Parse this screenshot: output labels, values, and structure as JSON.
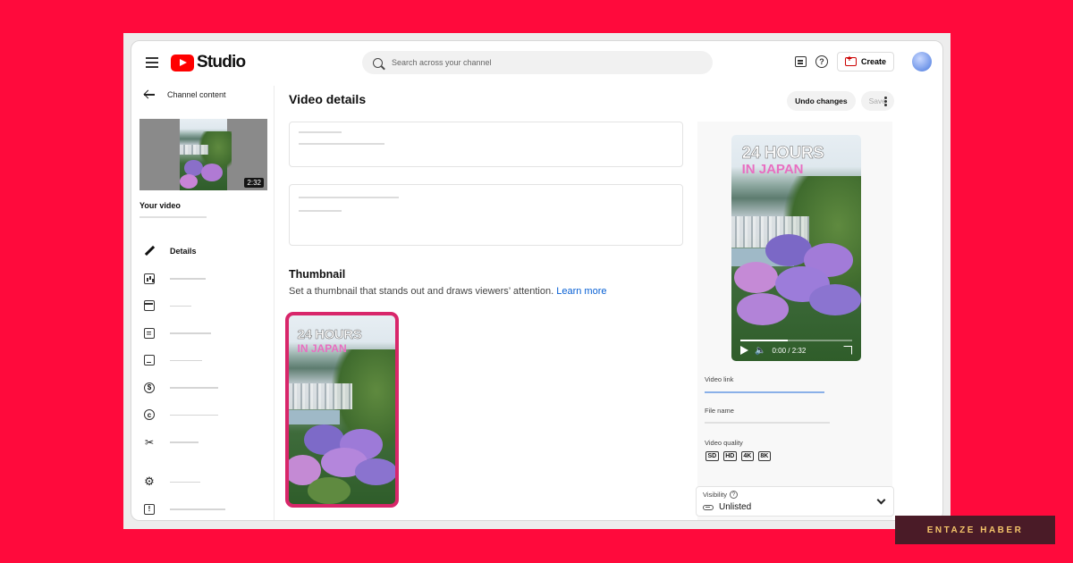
{
  "app": {
    "logo_text": "Studio"
  },
  "search": {
    "placeholder": "Search across your channel"
  },
  "header": {
    "create_label": "Create"
  },
  "sidebar": {
    "back_label": "Channel content",
    "video_duration": "2:32",
    "your_video_label": "Your video",
    "items": [
      {
        "icon": "pencil-icon",
        "label": "Details"
      },
      {
        "icon": "analytics-icon",
        "label": ""
      },
      {
        "icon": "editor-icon",
        "label": ""
      },
      {
        "icon": "comments-icon",
        "label": ""
      },
      {
        "icon": "subtitles-icon",
        "label": ""
      },
      {
        "icon": "monetization-icon",
        "label": ""
      },
      {
        "icon": "copyright-icon",
        "label": ""
      },
      {
        "icon": "scissors-icon",
        "label": ""
      },
      {
        "icon": "gear-icon",
        "label": ""
      },
      {
        "icon": "feedback-icon",
        "label": ""
      }
    ]
  },
  "main": {
    "title": "Video details",
    "undo_label": "Undo changes",
    "save_label": "Save",
    "thumbnail": {
      "title": "Thumbnail",
      "description": "Set a thumbnail that stands out and draws viewers’ attention.",
      "learn_more": "Learn more",
      "overlay_line1": "24 HOURS",
      "overlay_line2": "IN JAPAN"
    }
  },
  "preview": {
    "overlay_line1": "24 HOURS",
    "overlay_line2": "IN JAPAN",
    "time": "0:00 / 2:32",
    "progress": 0.42,
    "video_link_label": "Video link",
    "file_name_label": "File name",
    "video_quality_label": "Video quality",
    "quality_badges": [
      "SD",
      "HD",
      "4K",
      "8K"
    ]
  },
  "visibility": {
    "label": "Visibility",
    "value": "Unlisted"
  },
  "watermark": {
    "text": "ENTAZE HABER"
  },
  "colors": {
    "background": "#ff0a3c",
    "brand_red": "#ff0000",
    "accent_pink": "#d8266a",
    "link_blue": "#065fd4"
  }
}
